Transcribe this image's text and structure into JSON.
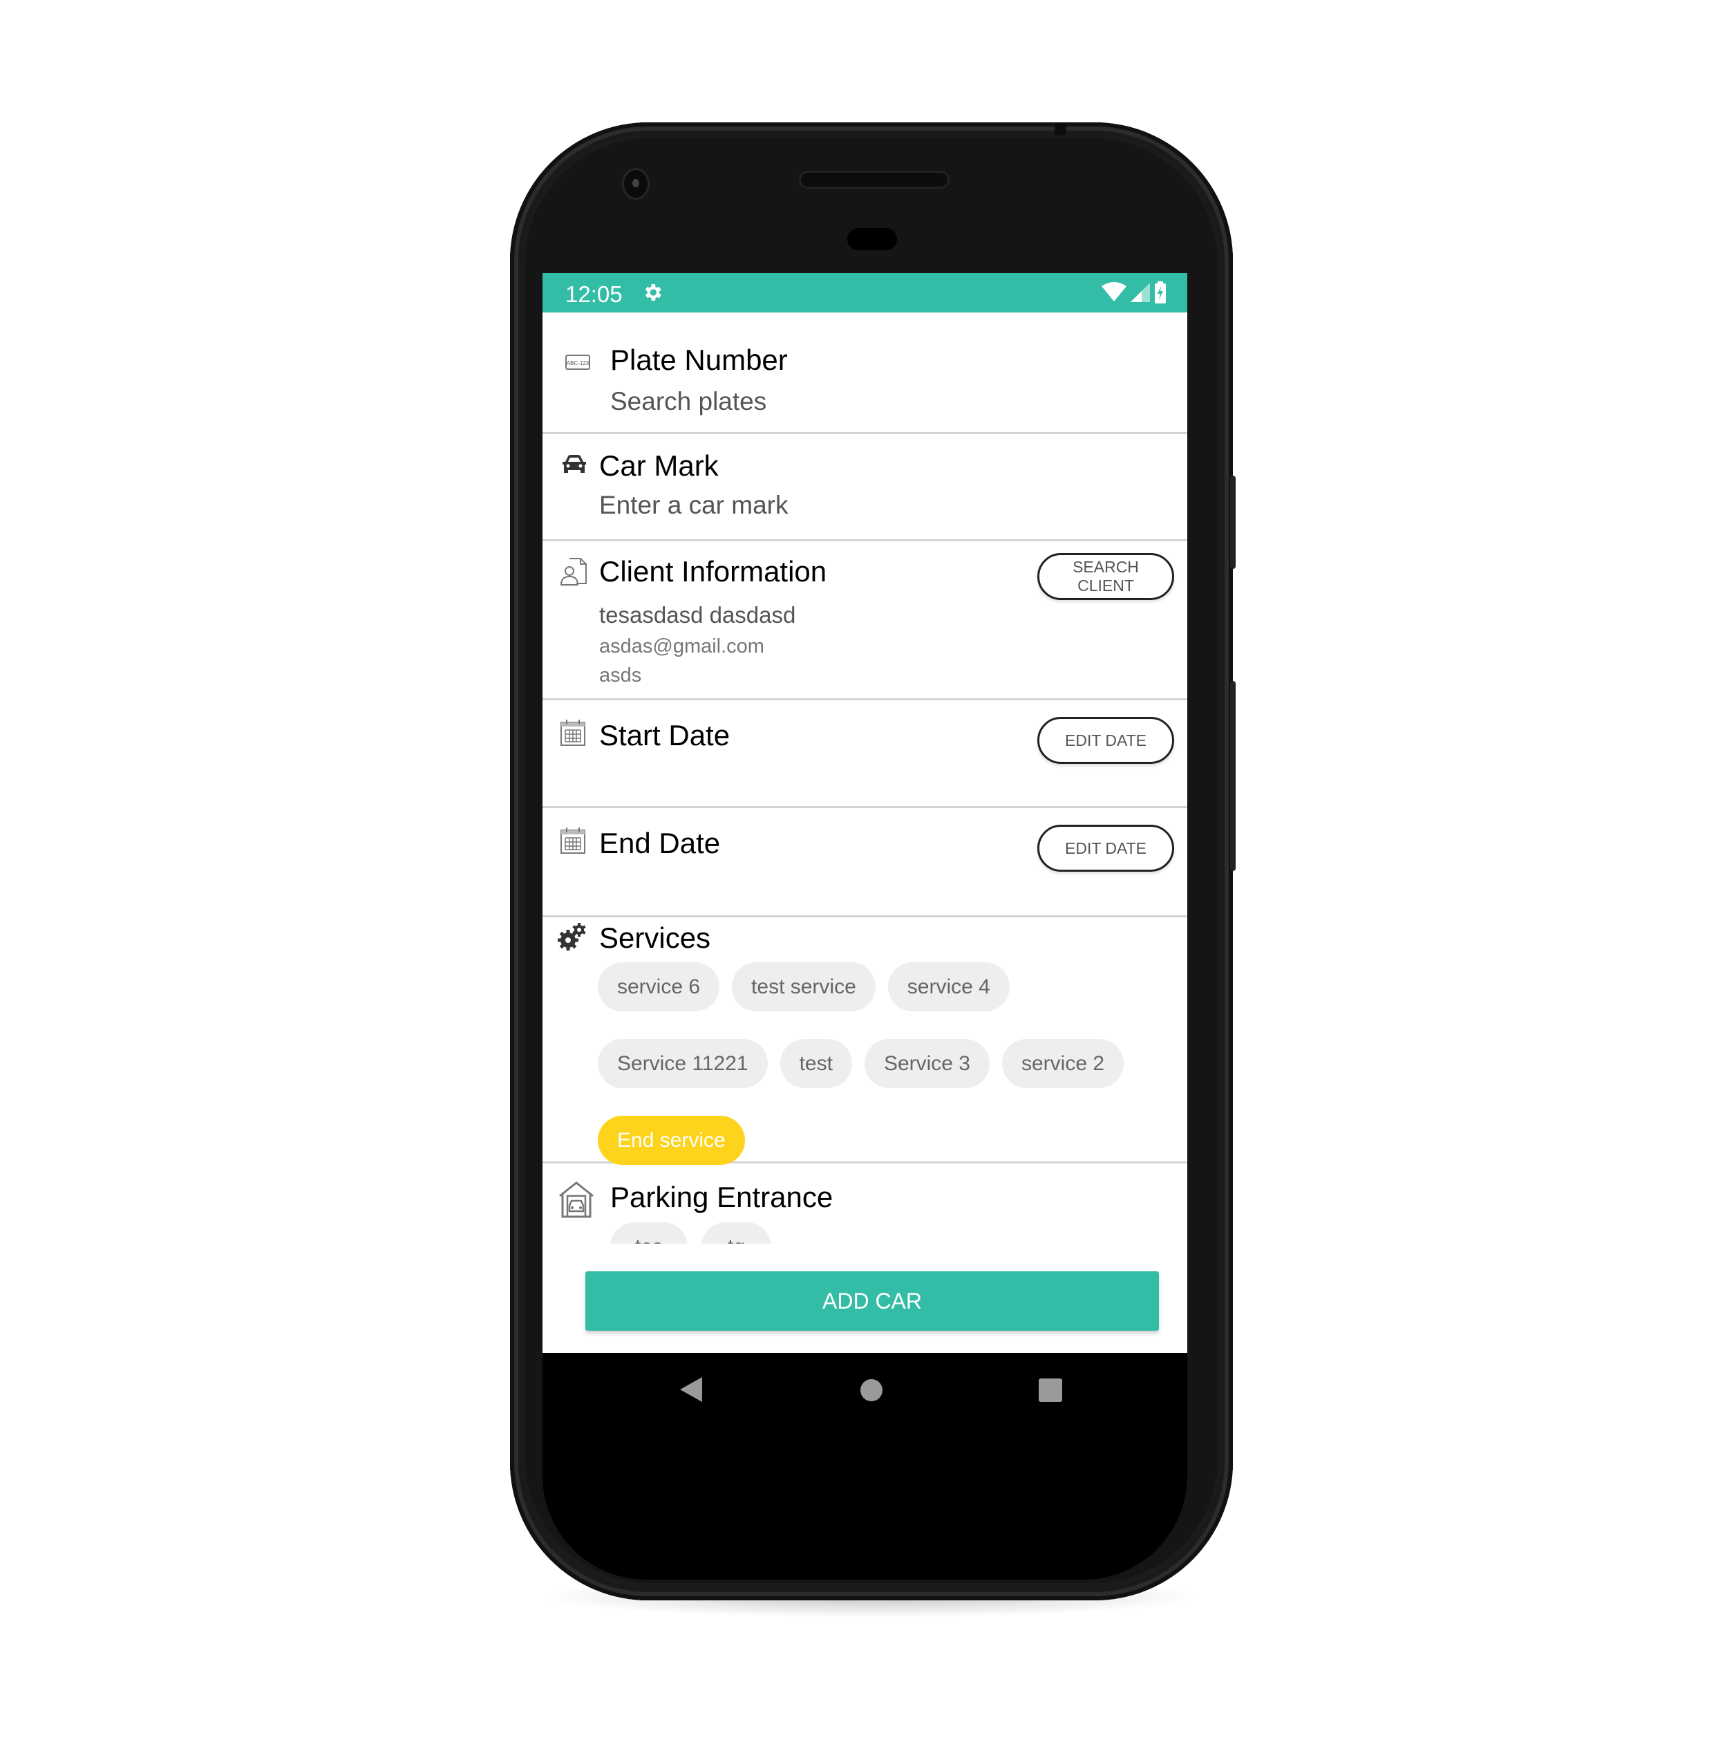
{
  "status_bar": {
    "time": "12:05",
    "icons": [
      "settings-gear-icon",
      "wifi-icon",
      "cell-signal-icon",
      "battery-charging-icon"
    ]
  },
  "form": {
    "plate": {
      "icon": "license-plate-icon",
      "icon_text": "ABC-123",
      "title": "Plate Number",
      "placeholder": "Search plates"
    },
    "car_mark": {
      "icon": "car-icon",
      "title": "Car Mark",
      "placeholder": "Enter a car mark"
    },
    "client": {
      "icon": "client-document-icon",
      "title": "Client Information",
      "button_label": "SEARCH CLIENT",
      "name": "tesasdasd dasdasd",
      "email": "asdas@gmail.com",
      "extra": "asds"
    },
    "start_date": {
      "icon": "calendar-icon",
      "title": "Start Date",
      "button_label": "EDIT DATE"
    },
    "end_date": {
      "icon": "calendar-icon",
      "title": "End Date",
      "button_label": "EDIT DATE"
    },
    "services": {
      "icon": "gears-icon",
      "title": "Services",
      "chips": [
        {
          "label": "service 6",
          "selected": false
        },
        {
          "label": "test service",
          "selected": false
        },
        {
          "label": "service 4",
          "selected": false
        },
        {
          "label": "Service 11221",
          "selected": false
        },
        {
          "label": "test",
          "selected": false
        },
        {
          "label": "Service 3",
          "selected": false
        },
        {
          "label": "service 2",
          "selected": false
        },
        {
          "label": "End service",
          "selected": true
        }
      ]
    },
    "parking": {
      "icon": "garage-icon",
      "title": "Parking Entrance",
      "chips": [
        {
          "label": "tes",
          "selected": false
        },
        {
          "label": "tg",
          "selected": false
        }
      ]
    },
    "submit_label": "ADD CAR"
  },
  "colors": {
    "accent": "#34bda6",
    "chip_selected": "#fdd31c",
    "chip_default": "#eeeeee"
  },
  "nav_bar": {
    "buttons": [
      "back-icon",
      "home-icon",
      "recents-icon"
    ]
  }
}
